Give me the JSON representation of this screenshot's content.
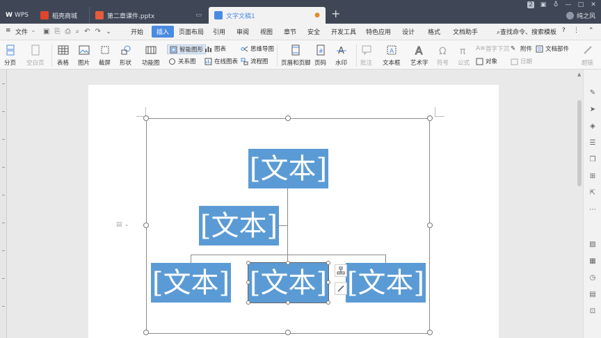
{
  "titlebar": {
    "tabs": [
      {
        "label": "WPS",
        "logo_color": "#3f4756"
      },
      {
        "label": "稻壳商城",
        "logo_color": "#e0452c"
      },
      {
        "label": "第二章课件.pptx",
        "logo_color": "#e55b3b"
      },
      {
        "label": "文字文稿1",
        "logo_color": "#4a8be0"
      }
    ],
    "badge": "2",
    "user": "纯之风"
  },
  "menubar": {
    "file": "文件",
    "items": [
      "开始",
      "插入",
      "页面布局",
      "引用",
      "审阅",
      "视图",
      "章节",
      "安全",
      "开发工具",
      "特色应用",
      "设计",
      "格式",
      "文档助手"
    ],
    "active": "插入",
    "search": "查找命令、搜索模板"
  },
  "ribbon": {
    "page_break": "分页",
    "blank_page": "空白页",
    "table": "表格",
    "picture": "图片",
    "screenshot": "截屏",
    "shape": "形状",
    "function_chart": "功能图",
    "smart_art": "智能图形",
    "chart": "图表",
    "mindmap": "思维导图",
    "relation": "关系图",
    "online_chart": "在线图表",
    "flowchart": "流程图",
    "header_footer": "页眉和页脚",
    "page_number": "页码",
    "watermark": "水印",
    "comment": "批注",
    "textbox": "文本框",
    "wordart": "艺术字",
    "symbol": "符号",
    "formula": "公式",
    "first_drop": "首字下沉",
    "attachment": "附件",
    "doc_parts": "文档部件",
    "object": "对象",
    "date": "日期",
    "hyperlink": "超链"
  },
  "smartart": {
    "boxes": [
      "[文本]",
      "[文本]",
      "[文本]",
      "[文本]",
      "[文本]"
    ],
    "box_color": "#5b9bd5"
  },
  "colors": {
    "accent": "#4a8be0",
    "titlebar_bg": "#3f4756",
    "box": "#5b9bd5"
  }
}
